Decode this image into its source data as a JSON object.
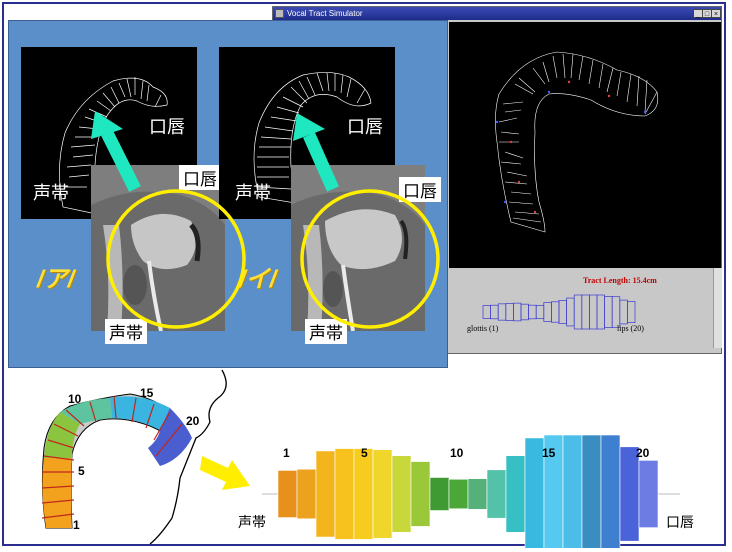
{
  "window": {
    "title": "Vocal Tract Simulator",
    "buttons": [
      "_",
      "□",
      "×"
    ],
    "tract_length": "Tract Length: 15.4cm",
    "glottis_label": "glottis (1)",
    "lips_label": "lips (20)"
  },
  "slide": {
    "lips_label": "口唇",
    "vocal_cords_label": "声帯",
    "vowel_a": "/ア/",
    "vowel_i": "/イ/"
  },
  "bottom": {
    "left_numbers": [
      "10",
      "15",
      "20",
      "5",
      "1"
    ],
    "section_numbers": [
      "1",
      "5",
      "10",
      "15",
      "20"
    ],
    "vocal_cords_label": "声帯",
    "lips_label": "口唇"
  },
  "colors": {
    "panel_blue": "#5b8fc9",
    "circle_yellow": "#ffee00",
    "arrow_cyan": "#1fe8c0",
    "title_blue": "#1e2c8a"
  },
  "tube_sections": [
    {
      "color": "#e8901c",
      "height": 0.4
    },
    {
      "color": "#eda21e",
      "height": 0.42
    },
    {
      "color": "#f3b51d",
      "height": 0.73
    },
    {
      "color": "#f7c21e",
      "height": 0.77
    },
    {
      "color": "#f7cc1f",
      "height": 0.77
    },
    {
      "color": "#f0d52a",
      "height": 0.75
    },
    {
      "color": "#c8d83a",
      "height": 0.65
    },
    {
      "color": "#9bc838",
      "height": 0.55
    },
    {
      "color": "#3f9a34",
      "height": 0.28
    },
    {
      "color": "#4ba838",
      "height": 0.25
    },
    {
      "color": "#55b07a",
      "height": 0.26
    },
    {
      "color": "#54c2a8",
      "height": 0.41
    },
    {
      "color": "#36c0c4",
      "height": 0.65
    },
    {
      "color": "#3ab9e0",
      "height": 0.95
    },
    {
      "color": "#55c9ef",
      "height": 1.0
    },
    {
      "color": "#4cbde8",
      "height": 1.0
    },
    {
      "color": "#3a8dc0",
      "height": 1.0
    },
    {
      "color": "#3e7fd0",
      "height": 1.0
    },
    {
      "color": "#4a63d8",
      "height": 0.8
    },
    {
      "color": "#6c7ce2",
      "height": 0.57
    }
  ],
  "sim_tube_heights": [
    0.38,
    0.4,
    0.48,
    0.5,
    0.52,
    0.46,
    0.4,
    0.38,
    0.56,
    0.6,
    0.68,
    0.82,
    1.0,
    1.0,
    1.0,
    1.0,
    0.92,
    0.9,
    0.7,
    0.62
  ]
}
